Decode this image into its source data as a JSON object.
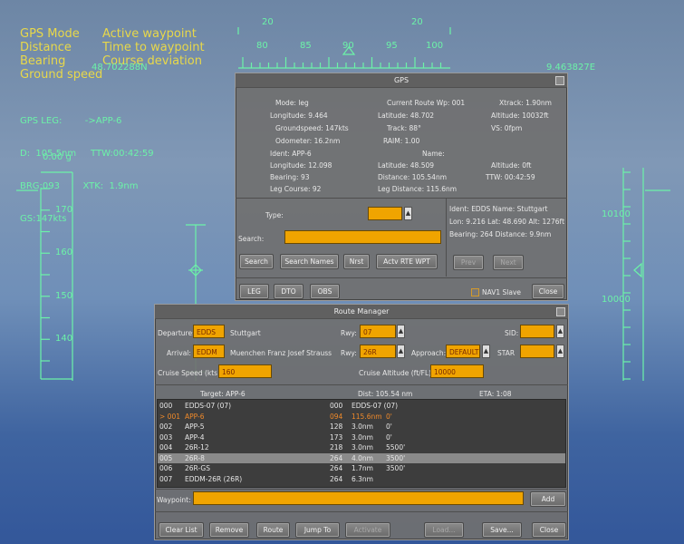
{
  "legend": [
    {
      "left": "GPS Mode",
      "right": "Active waypoint"
    },
    {
      "left": "Distance",
      "right": "Time to waypoint"
    },
    {
      "left": "Bearing",
      "right": "Course deviation"
    },
    {
      "left": "Ground speed",
      "right": ""
    }
  ],
  "hud": {
    "latitude_readout": "48.702288N",
    "longitude_readout": "9.463827E",
    "gps_lines": [
      "GPS LEG:        ->APP-6",
      "D:  105.5nm     TTW:00:42:59",
      "BRG:093        XTK:  1.9nm",
      "GS:147kts"
    ],
    "heading_marks": [
      "20",
      "20"
    ],
    "heading_ticks": [
      "80",
      "85",
      "90",
      "95",
      "100"
    ],
    "g_readout": "0.00 g",
    "speed_ticks": [
      "170",
      "160",
      "150",
      "140"
    ],
    "alt_ticks": [
      "10100",
      "10000"
    ]
  },
  "gps": {
    "title": "GPS",
    "info": {
      "mode": "Mode: leg",
      "current_route_wp": "Current Route Wp: 001",
      "xtrack": "Xtrack:  1.90nm",
      "longitude": "Longitude:  9.464",
      "latitude": "Latitude:  48.702",
      "altitude": "Altitude:  10032ft",
      "groundspeed": "Groundspeed:  147kts",
      "track": "Track:  88°",
      "vs": "VS:    0fpm",
      "odometer": "Odometer:  16.2nm",
      "raim": "RAIM:  1.00",
      "ident": "Ident:  APP-6",
      "name": "Name:",
      "wp_longitude": "Longitude:  12.098",
      "wp_latitude": "Latitude:  48.509",
      "wp_altitude": "Altitude:      0ft",
      "bearing": "Bearing:  93",
      "distance": "Distance:  105.54nm",
      "ttw": "TTW:  00:42:59",
      "leg_course": "Leg Course:  92",
      "leg_distance": "Leg Distance:  115.6nm"
    },
    "type_label": "Type:",
    "search_label": "Search:",
    "buttons": {
      "search": "Search",
      "search_names": "Search Names",
      "nrst": "Nrst",
      "actv_rte_wpt": "Actv RTE WPT"
    },
    "result": {
      "line1": "Ident:  EDDS    Name:  Stuttgart",
      "line2": "Lon:  9.216   Lat:  48.690   Alt:   1276ft",
      "line3": "Bearing:  264  Distance:    9.9nm"
    },
    "prev": "Prev",
    "next": "Next",
    "mode_buttons": {
      "leg": "LEG",
      "dto": "DTO",
      "obs": "OBS"
    },
    "nav1_slave": "NAV1 Slave",
    "close": "Close"
  },
  "route": {
    "title": "Route Manager",
    "departure_label": "Departure:",
    "departure_value": "EDDS",
    "departure_name": "Stuttgart",
    "dep_rwy_label": "Rwy:",
    "dep_rwy_value": "07",
    "sid_label": "SID:",
    "arrival_label": "Arrival:",
    "arrival_value": "EDDM",
    "arrival_name": "Muenchen Franz Josef Strauss",
    "arr_rwy_label": "Rwy:",
    "arr_rwy_value": "26R",
    "approach_label": "Approach:",
    "approach_value": "DEFAULT",
    "star_label": "STAR",
    "cruise_speed_label": "Cruise Speed (kts):",
    "cruise_speed_value": "160",
    "cruise_alt_label": "Cruise Altitude (ft/FL):",
    "cruise_alt_value": "10000",
    "target": "Target: APP-6",
    "dist": "Dist: 105.54 nm",
    "eta": "ETA: 1:08",
    "rows": [
      {
        "a": "  000",
        "b": "EDDS-07 (07)",
        "c": "000",
        "d": "EDDS-07 (07)",
        "e": "",
        "sel": false,
        "cur": false
      },
      {
        "a": "> 001",
        "b": "APP-6",
        "c": "094",
        "d": "115.6nm",
        "e": "0'",
        "sel": false,
        "cur": true
      },
      {
        "a": "  002",
        "b": "APP-5",
        "c": "128",
        "d": "3.0nm",
        "e": "0'",
        "sel": false,
        "cur": false
      },
      {
        "a": "  003",
        "b": "APP-4",
        "c": "173",
        "d": "3.0nm",
        "e": "0'",
        "sel": false,
        "cur": false
      },
      {
        "a": "  004",
        "b": "26R-12",
        "c": "218",
        "d": "3.0nm",
        "e": "5500'",
        "sel": false,
        "cur": false
      },
      {
        "a": "  005",
        "b": "26R-8",
        "c": "264",
        "d": "4.0nm",
        "e": "3500'",
        "sel": true,
        "cur": false
      },
      {
        "a": "  006",
        "b": "26R-GS",
        "c": "264",
        "d": "1.7nm",
        "e": "3500'",
        "sel": false,
        "cur": false
      },
      {
        "a": "  007",
        "b": "EDDM-26R (26R)",
        "c": "264",
        "d": "6.3nm",
        "e": "",
        "sel": false,
        "cur": false
      }
    ],
    "waypoint_label": "Waypoint:",
    "add": "Add",
    "buttons": {
      "clear": "Clear List",
      "remove": "Remove",
      "route": "Route",
      "jump": "Jump To",
      "activate": "Activate",
      "load": "Load...",
      "save": "Save...",
      "close": "Close"
    }
  }
}
